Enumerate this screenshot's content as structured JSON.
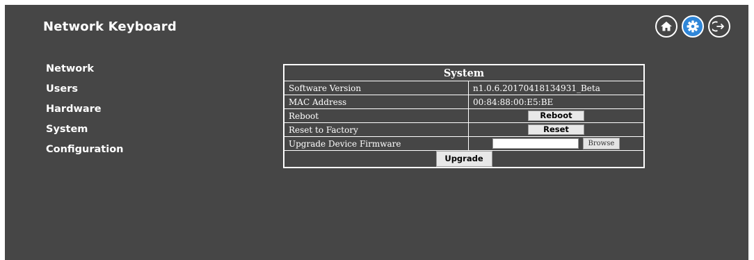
{
  "header": {
    "title": "Network Keyboard",
    "icons": [
      "home-icon",
      "gear-icon",
      "logout-icon"
    ],
    "active_icon_color": "#2f86d8"
  },
  "sidebar": {
    "items": [
      {
        "label": "Network"
      },
      {
        "label": "Users"
      },
      {
        "label": "Hardware"
      },
      {
        "label": "System"
      },
      {
        "label": "Configuration"
      }
    ]
  },
  "system": {
    "heading": "System",
    "software_version_label": "Software Version",
    "software_version_value": "n1.0.6.20170418134931_Beta",
    "mac_label": "MAC Address",
    "mac_value": "00:84:88:00:E5:BE",
    "reboot_label": "Reboot",
    "reboot_button": "Reboot",
    "reset_label": "Reset to Factory",
    "reset_button": "Reset",
    "upgrade_label": "Upgrade Device Firmware",
    "file_value": "",
    "browse_button": "Browse",
    "upgrade_button": "Upgrade"
  },
  "colors": {
    "background": "#464646",
    "text": "#ffffff"
  }
}
